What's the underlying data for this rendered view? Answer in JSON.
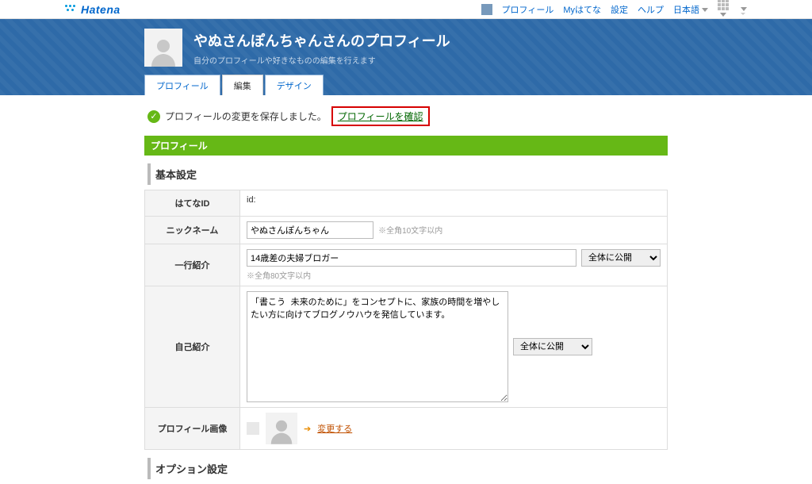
{
  "topbar": {
    "brand": "Hatena",
    "links": {
      "profile": "プロフィール",
      "myhatena": "Myはてな",
      "settings": "設定",
      "help": "ヘルプ",
      "language": "日本語"
    }
  },
  "hero": {
    "title": "やぬさんぽんちゃんさんのプロフィール",
    "subtitle": "自分のプロフィールや好きなものの編集を行えます"
  },
  "tabs": {
    "profile": "プロフィール",
    "edit": "編集",
    "design": "デザイン",
    "active": "edit"
  },
  "notice": {
    "message": "プロフィールの変更を保存しました。",
    "link": "プロフィールを確認"
  },
  "section": {
    "profile": "プロフィール",
    "basic": "基本設定",
    "option": "オプション設定"
  },
  "form": {
    "labels": {
      "hatena_id": "はてなID",
      "nickname": "ニックネーム",
      "oneline": "一行紹介",
      "selfintro": "自己紹介",
      "profile_image": "プロフィール画像"
    },
    "id_prefix": "id:",
    "nickname_value": "やぬさんぽんちゃん",
    "nickname_hint": "※全角10文字以内",
    "oneline_value": "14歳差の夫婦ブロガー",
    "oneline_hint": "※全角80文字以内",
    "selfintro_value": "「書こう 未来のために」をコンセプトに、家族の時間を増やしたい方に向けてブログノウハウを発信しています。",
    "visibility_options": [
      "全体に公開"
    ],
    "visibility_selected": "全体に公開",
    "change_link": "変更する"
  }
}
